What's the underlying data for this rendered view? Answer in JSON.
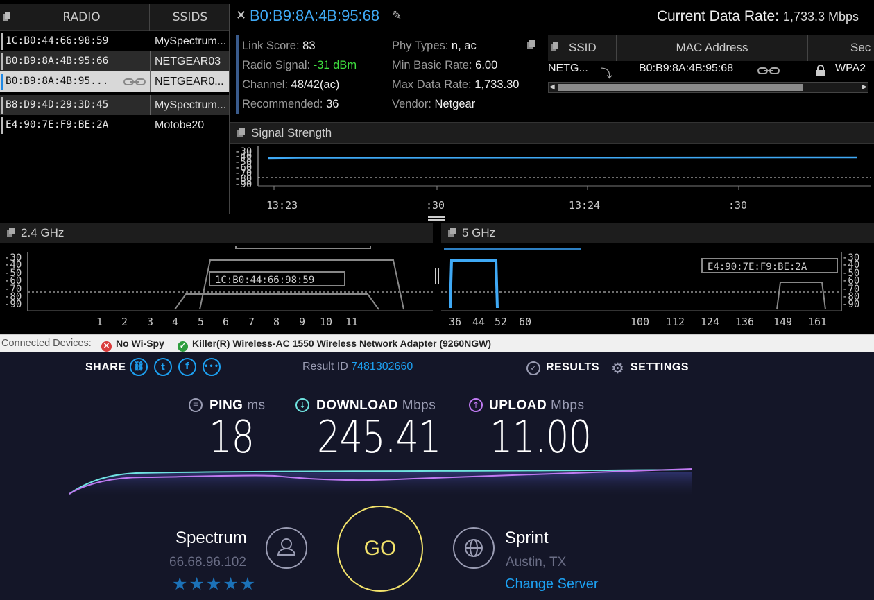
{
  "radio_table": {
    "col_radio": "RADIO",
    "col_ssids": "SSIDS",
    "rows": [
      {
        "mac": "1C:B0:44:66:98:59",
        "ssid": "MySpectrum..."
      },
      {
        "mac": "B0:B9:8A:4B:95:66",
        "ssid": "NETGEAR03"
      },
      {
        "mac": "B0:B9:8A:4B:95...",
        "ssid": "NETGEAR0..."
      },
      {
        "mac": "B8:D9:4D:29:3D:45",
        "ssid": "MySpectrum..."
      },
      {
        "mac": "E4:90:7E:F9:BE:2A",
        "ssid": "Motobe20"
      }
    ]
  },
  "detail": {
    "title": "B0:B9:8A:4B:95:68",
    "rate_label": "Current Data Rate:",
    "rate_value": "1,733.3 Mbps",
    "link_score_label": "Link Score:",
    "link_score": "83",
    "radio_signal_label": "Radio Signal:",
    "radio_signal": "-31 dBm",
    "channel_label": "Channel:",
    "channel": "48/42(ac)",
    "recommended_label": "Recommended:",
    "recommended": "36",
    "phy_label": "Phy Types:",
    "phy": "n, ac",
    "min_rate_label": "Min Basic Rate:",
    "min_rate": "6.00",
    "max_rate_label": "Max Data Rate:",
    "max_rate": "1,733.30",
    "vendor_label": "Vendor:",
    "vendor": "Netgear",
    "mini_table": {
      "col_ssid": "SSID",
      "col_mac": "MAC Address",
      "col_sec": "Sec",
      "row_ssid": "NETG...",
      "row_mac": "B0:B9:8A:4B:95:68",
      "row_sec": "WPA2"
    }
  },
  "signal": {
    "title": "Signal Strength",
    "y_ticks": [
      "-30",
      "-40",
      "-50",
      "-60",
      "-70",
      "-80",
      "-90"
    ],
    "x_ticks": [
      "13:23",
      ":30",
      "13:24",
      ":30"
    ]
  },
  "ghz24": {
    "title": "2.4 GHz",
    "y_ticks": [
      "-30",
      "-40",
      "-50",
      "-60",
      "-70",
      "-80",
      "-90"
    ],
    "channels": [
      "1",
      "2",
      "3",
      "4",
      "5",
      "6",
      "7",
      "8",
      "9",
      "10",
      "11"
    ],
    "label": "1C:B0:44:66:98:59"
  },
  "ghz5": {
    "title": "5 GHz",
    "y_ticks": [
      "-30",
      "-40",
      "-50",
      "-60",
      "-70",
      "-80",
      "-90"
    ],
    "channels": [
      "36",
      "44",
      "52",
      "60",
      "100",
      "112",
      "124",
      "136",
      "149",
      "161"
    ],
    "label": "E4:90:7E:F9:BE:2A"
  },
  "status": {
    "label": "Connected Devices:",
    "device1": "No Wi-Spy",
    "device2": "Killer(R) Wireless-AC 1550 Wireless Network Adapter (9260NGW)"
  },
  "speedtest": {
    "share": "SHARE",
    "result_label": "Result ID",
    "result_id": "7481302660",
    "results": "RESULTS",
    "settings": "SETTINGS",
    "ping_label": "PING",
    "ping_unit": "ms",
    "ping": "18",
    "download_label": "DOWNLOAD",
    "download_unit": "Mbps",
    "download": "245.41",
    "upload_label": "UPLOAD",
    "upload_unit": "Mbps",
    "upload": "11.00",
    "go": "GO",
    "isp": "Spectrum",
    "ip": "66.68.96.102",
    "rating_stars": 5,
    "server": "Sprint",
    "location": "Austin, TX",
    "change_server": "Change Server",
    "colors": {
      "accent": "#1da1f2",
      "download": "#6fe3e0",
      "upload": "#c07af2",
      "go": "#f2e26b"
    }
  }
}
